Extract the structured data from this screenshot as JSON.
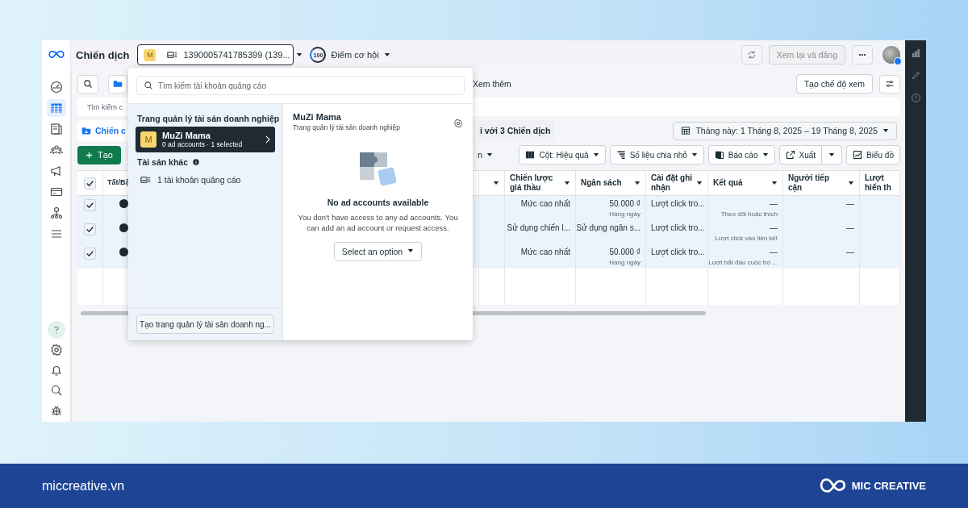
{
  "header": {
    "title": "Chiến dịch",
    "account_selector": {
      "badge": "M",
      "label": "1390005741785399 (139..."
    },
    "score": {
      "value": "100",
      "label": "Điểm cơ hội"
    },
    "review_button": {
      "label": "Xem lại và đăng",
      "disabled": true
    }
  },
  "nav_items": [
    {
      "kind": "dashboard",
      "selected": false
    },
    {
      "kind": "table",
      "selected": true
    },
    {
      "kind": "pages",
      "selected": false
    },
    {
      "kind": "people",
      "selected": false
    },
    {
      "kind": "megaphone",
      "selected": false
    },
    {
      "kind": "card",
      "selected": false
    },
    {
      "kind": "network",
      "selected": false
    },
    {
      "kind": "menu",
      "selected": false
    }
  ],
  "tool_items": [
    {
      "kind": "help"
    },
    {
      "kind": "settings"
    },
    {
      "kind": "bell"
    },
    {
      "kind": "search"
    },
    {
      "kind": "bug"
    }
  ],
  "side_tools": [
    {
      "kind": "chart"
    },
    {
      "kind": "pencil"
    },
    {
      "kind": "clock"
    }
  ],
  "toolbar": {
    "more_label": "Xem thêm",
    "create_view": "Tạo chế độ xem"
  },
  "search": {
    "placeholder": "Tìm kiếm c"
  },
  "tabs": [
    {
      "label": "Chiến c",
      "selected": true
    },
    {
      "label": "i với 3 Chiến dịch",
      "selected": false
    }
  ],
  "date_range": "Tháng này: 1 Tháng 8, 2025 – 19 Tháng 8, 2025",
  "actions": {
    "create": "Tạo",
    "partial": "n",
    "buttons": [
      {
        "kind": "columns",
        "label": "Cột: Hiệu quả"
      },
      {
        "kind": "breakdown",
        "label": "Số liệu chia nhỏ"
      },
      {
        "kind": "reports",
        "label": "Báo cáo"
      },
      {
        "kind": "export",
        "label": "Xuất"
      },
      {
        "kind": "chart",
        "label": "Biểu đồ"
      }
    ]
  },
  "table": {
    "header_checked": true,
    "columns": [
      "Tất/Bậ",
      "Chiến lược giá thầu",
      "Ngân sách",
      "Cài đặt ghi nhận",
      "Kết quả",
      "Người tiếp cận",
      "Lượt hiển th"
    ],
    "rows": [
      {
        "checked": true,
        "bid": "Mức cao nhất",
        "budget": "50.000 ₫",
        "budget_note": "Hàng ngày",
        "attribution": "Lượt click tro...",
        "result": "—",
        "result_note": "Theo dõi hoặc thích",
        "reach": "—"
      },
      {
        "checked": true,
        "bid": "Sử dụng chiến l...",
        "budget": "Sử dụng ngân s...",
        "attribution": "Lượt click tro...",
        "result": "—",
        "result_note": "Lượt click vào liên kết",
        "reach": "—"
      },
      {
        "checked": true,
        "bid": "Mức cao nhất",
        "budget": "50.000 ₫",
        "budget_note": "Hàng ngày",
        "attribution": "Lượt click tro...",
        "result": "—",
        "result_note": "Lượt bắt đầu cuộc trò ...",
        "reach": "—"
      }
    ]
  },
  "popup": {
    "search_placeholder": "Tìm kiếm tài khoản quảng cáo",
    "section_title": "Trang quản lý tài sản doanh nghiệp",
    "businesses": [
      {
        "badge": "M",
        "name": "MuZi Mama",
        "meta": "0 ad accounts · 1 selected",
        "selected": true
      }
    ],
    "other_title": "Tài sản khác",
    "other_items": [
      {
        "label": "1 tài khoản quảng cáo"
      }
    ],
    "create_button": "Tạo trang quản lý tài sản doanh ng...",
    "detail": {
      "title": "MuZi Mama",
      "subtitle": "Trang quản lý tài sản doanh nghiệp",
      "empty_title": "No ad accounts available",
      "empty_text": "You don't have access to any ad accounts. You can add an ad account or request access.",
      "select_label": "Select an option"
    }
  },
  "frame": {
    "site": "miccreative.vn",
    "brand": "MIC CREATIVE"
  }
}
